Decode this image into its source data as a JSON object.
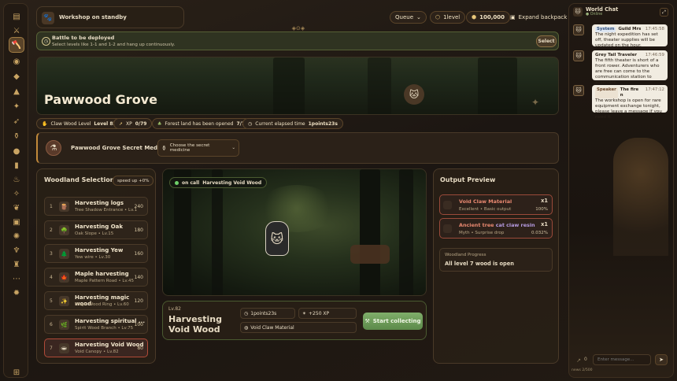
{
  "topbar": {
    "title": "Workshop on standby",
    "queue_label": "Queue",
    "level": "1level",
    "coins": "100,000",
    "backpack_label": "Expand backpack"
  },
  "banner": {
    "title": "Battle to be deployed",
    "subtitle": "Select levels like 1-1 and 1-2 and hang up continuously.",
    "button": "Select"
  },
  "hero": {
    "title": "Pawwood Grove"
  },
  "stats": {
    "level_label": "Claw Wood Level",
    "level_value": "Level 82",
    "xp_label": "XP",
    "xp_value": "0/79",
    "forest_label": "Forest land has been opened",
    "forest_value": "7/7",
    "elapsed_label": "Current elapsed time",
    "elapsed_value": "1points23s"
  },
  "medicine": {
    "title": "Pawwood Grove Secret Medicine",
    "select_label": "Choose the secret medicine"
  },
  "woodland": {
    "title": "Woodland Selection",
    "speed": "speed up +0%",
    "items": [
      {
        "num": "1",
        "name": "Harvesting logs",
        "sub": "Tree Shadow Entrance • Lv.1",
        "value": "240"
      },
      {
        "num": "2",
        "name": "Harvesting Oak",
        "sub": "Oak Slope • Lv.15",
        "value": "180"
      },
      {
        "num": "3",
        "name": "Harvesting Yew",
        "sub": "Yew wire • Lv.30",
        "value": "160"
      },
      {
        "num": "4",
        "name": "Maple harvesting",
        "sub": "Maple Pattern Road • Lv.45",
        "value": "140"
      },
      {
        "num": "5",
        "name": "Harvesting magic wood",
        "sub": "Magic Wood Ring • Lv.60",
        "value": "120"
      },
      {
        "num": "6",
        "name": "Harvesting spiritual ...",
        "sub": "Spirit Wood Branch • Lv.75",
        "value": "100"
      },
      {
        "num": "7",
        "name": "Harvesting Void Wood",
        "sub": "Void Canopy • Lv.82",
        "value": "80"
      }
    ]
  },
  "scene": {
    "status": "on call",
    "activity": "Harvesting Void Wood"
  },
  "action": {
    "level": "Lv.82",
    "title": "Harvesting Void Wood",
    "time": "1points23s",
    "xp": "+250 XP",
    "material": "Void Claw Material",
    "button": "Start collecting"
  },
  "output": {
    "title": "Output Preview",
    "items": [
      {
        "name": "Void Claw Material",
        "desc": "Excellent • Basic output",
        "qty": "x1",
        "pct": "100%"
      },
      {
        "name_a": "Ancient tree",
        "name_b": "cat claw resin",
        "desc": "Myth • Surprise drop",
        "qty": "x1",
        "pct": "0.032%"
      }
    ],
    "progress_label": "Woodland Progress",
    "progress_value": "All level 7 wood is open"
  },
  "chat": {
    "title": "World Chat",
    "status": "Online",
    "messages": [
      {
        "role": "System",
        "name": "Guild Mrs",
        "time": "17:45:58",
        "text": "The night expedition has set off, theater supplies will be updated on the hour."
      },
      {
        "role": "",
        "name": "Grey Tail Traveler",
        "time": "17:46:59",
        "text": "The fifth theater is short of a front rower. Adventurers who are free can come to the communication station to assemble."
      },
      {
        "role": "Speaker",
        "name": "The fire n",
        "time": "17:47:12",
        "text": "The workshop is open for rare equipment exchange tonight, please leave a message if you need it."
      }
    ],
    "input_placeholder": "Enter message...",
    "counter": "0",
    "news": "news 2/500"
  }
}
